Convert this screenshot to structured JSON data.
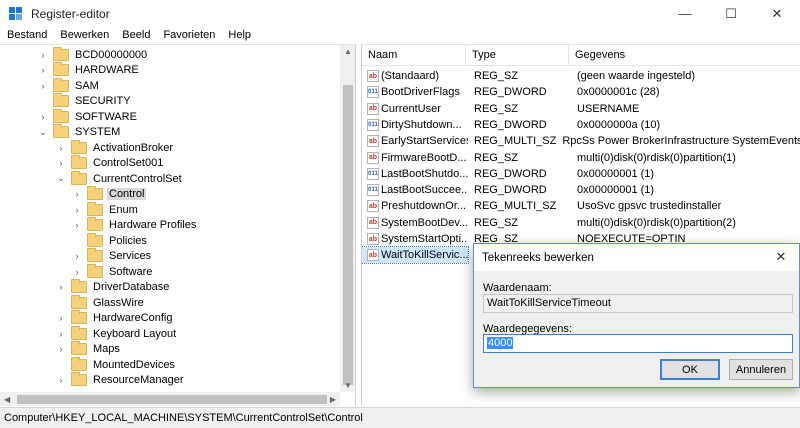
{
  "window": {
    "title": "Register-editor",
    "minimize": "—",
    "maximize": "☐",
    "close": "✕"
  },
  "menu": [
    "Bestand",
    "Bewerken",
    "Beeld",
    "Favorieten",
    "Help"
  ],
  "tree": [
    {
      "label": "BCD00000000",
      "level": 1,
      "expander": "›"
    },
    {
      "label": "HARDWARE",
      "level": 1,
      "expander": "›"
    },
    {
      "label": "SAM",
      "level": 1,
      "expander": "›"
    },
    {
      "label": "SECURITY",
      "level": 1,
      "expander": ""
    },
    {
      "label": "SOFTWARE",
      "level": 1,
      "expander": "›"
    },
    {
      "label": "SYSTEM",
      "level": 1,
      "expander": "⌄"
    },
    {
      "label": "ActivationBroker",
      "level": 2,
      "expander": "›"
    },
    {
      "label": "ControlSet001",
      "level": 2,
      "expander": "›"
    },
    {
      "label": "CurrentControlSet",
      "level": 2,
      "expander": "⌄"
    },
    {
      "label": "Control",
      "level": 3,
      "expander": "›",
      "selected": true
    },
    {
      "label": "Enum",
      "level": 3,
      "expander": "›"
    },
    {
      "label": "Hardware Profiles",
      "level": 3,
      "expander": "›"
    },
    {
      "label": "Policies",
      "level": 3,
      "expander": ""
    },
    {
      "label": "Services",
      "level": 3,
      "expander": "›"
    },
    {
      "label": "Software",
      "level": 3,
      "expander": "›"
    },
    {
      "label": "DriverDatabase",
      "level": 2,
      "expander": "›"
    },
    {
      "label": "GlassWire",
      "level": 2,
      "expander": ""
    },
    {
      "label": "HardwareConfig",
      "level": 2,
      "expander": "›"
    },
    {
      "label": "Keyboard Layout",
      "level": 2,
      "expander": "›"
    },
    {
      "label": "Maps",
      "level": 2,
      "expander": "›"
    },
    {
      "label": "MountedDevices",
      "level": 2,
      "expander": ""
    },
    {
      "label": "ResourceManager",
      "level": 2,
      "expander": "›"
    }
  ],
  "list": {
    "headers": [
      "Naam",
      "Type",
      "Gegevens"
    ],
    "rows": [
      {
        "icon": "ab",
        "name": "(Standaard)",
        "type": "REG_SZ",
        "data": "(geen waarde ingesteld)"
      },
      {
        "icon": "011",
        "name": "BootDriverFlags",
        "type": "REG_DWORD",
        "data": "0x0000001c (28)"
      },
      {
        "icon": "ab",
        "name": "CurrentUser",
        "type": "REG_SZ",
        "data": "USERNAME"
      },
      {
        "icon": "011",
        "name": "DirtyShutdown...",
        "type": "REG_DWORD",
        "data": "0x0000000a (10)"
      },
      {
        "icon": "ab",
        "name": "EarlyStartServices",
        "type": "REG_MULTI_SZ",
        "data": "RpcSs Power BrokerInfrastructure SystemEventsBr"
      },
      {
        "icon": "ab",
        "name": "FirmwareBootD...",
        "type": "REG_SZ",
        "data": "multi(0)disk(0)rdisk(0)partition(1)"
      },
      {
        "icon": "011",
        "name": "LastBootShutdo...",
        "type": "REG_DWORD",
        "data": "0x00000001 (1)"
      },
      {
        "icon": "011",
        "name": "LastBootSuccee...",
        "type": "REG_DWORD",
        "data": "0x00000001 (1)"
      },
      {
        "icon": "ab",
        "name": "PreshutdownOr...",
        "type": "REG_MULTI_SZ",
        "data": "UsoSvc gpsvc trustedinstaller"
      },
      {
        "icon": "ab",
        "name": "SystemBootDev...",
        "type": "REG_SZ",
        "data": "multi(0)disk(0)rdisk(0)partition(2)"
      },
      {
        "icon": "ab",
        "name": "SystemStartOpti...",
        "type": "REG_SZ",
        "data": " NOEXECUTE=OPTIN"
      },
      {
        "icon": "ab",
        "name": "WaitToKillServic...",
        "type": "R",
        "data": "",
        "focused": true
      }
    ]
  },
  "statusbar": {
    "path": "Computer\\HKEY_LOCAL_MACHINE\\SYSTEM\\CurrentControlSet\\Control"
  },
  "dialog": {
    "title": "Tekenreeks bewerken",
    "close": "✕",
    "name_label": "Waardenaam:",
    "name_value": "WaitToKillServiceTimeout",
    "data_label": "Waardegegevens:",
    "data_value": "4000",
    "ok": "OK",
    "cancel": "Annuleren"
  },
  "colors": {
    "accent": "#3c7fd5",
    "folder": "#f4d17a",
    "selection": "#3390ff"
  }
}
